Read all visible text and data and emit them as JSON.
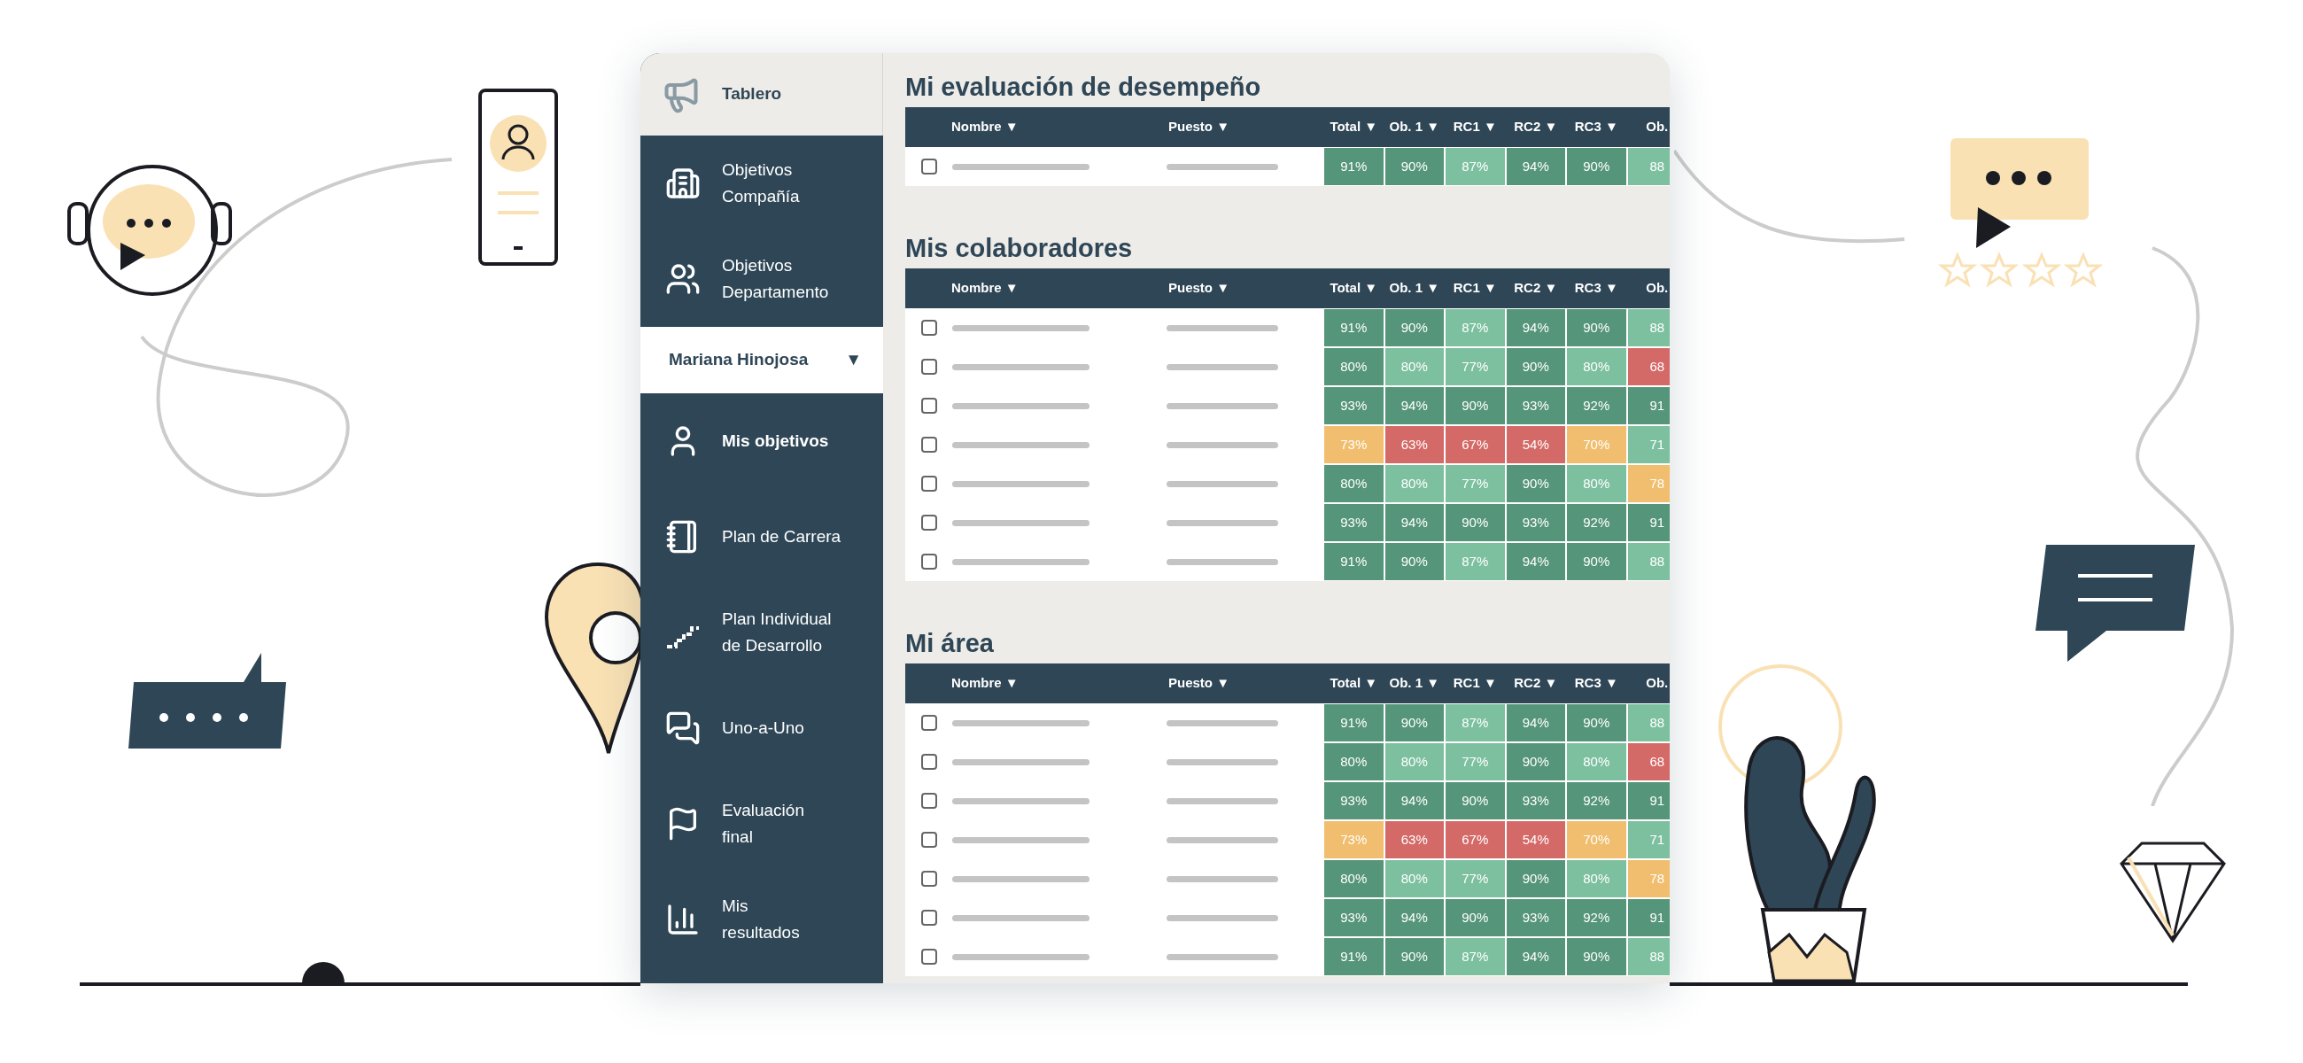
{
  "sidebar": {
    "items": [
      {
        "kind": "header",
        "lines": [
          "Tablero"
        ],
        "selected": false
      },
      {
        "kind": "nav",
        "lines": [
          "Objetivos",
          "Compañía"
        ],
        "selected": false
      },
      {
        "kind": "nav",
        "lines": [
          "Objetivos",
          "Departamento"
        ],
        "selected": false
      },
      {
        "kind": "user",
        "lines": [
          "Mariana Hinojosa"
        ],
        "caret": "▼",
        "selected": false
      },
      {
        "kind": "nav",
        "lines": [
          "Mis objetivos"
        ],
        "selected": true
      },
      {
        "kind": "nav",
        "lines": [
          "Plan de Carrera"
        ],
        "selected": false
      },
      {
        "kind": "nav",
        "lines": [
          "Plan Individual",
          "de Desarrollo"
        ],
        "selected": false
      },
      {
        "kind": "nav",
        "lines": [
          "Uno-a-Uno"
        ],
        "selected": false
      },
      {
        "kind": "nav",
        "lines": [
          "Evaluación",
          "final"
        ],
        "selected": false
      },
      {
        "kind": "nav",
        "lines": [
          "Mis",
          "resultados"
        ],
        "selected": false
      }
    ]
  },
  "sections": [
    {
      "title": "Mi evaluación de desempeño",
      "name_header": "Nombre ▼",
      "position_header": "Puesto ▼",
      "score_columns": [
        "Total ▼",
        "Ob. 1 ▼",
        "RC1 ▼",
        "RC2 ▼",
        "RC3 ▼",
        "Ob."
      ],
      "rows": [
        {
          "checked": false,
          "cells": [
            {
              "value": "91%",
              "color": "#559579"
            },
            {
              "value": "90%",
              "color": "#559579"
            },
            {
              "value": "87%",
              "color": "#7dc09f"
            },
            {
              "value": "94%",
              "color": "#559579"
            },
            {
              "value": "90%",
              "color": "#559579"
            },
            {
              "value": "88",
              "color": "#7dc09f"
            }
          ]
        }
      ]
    },
    {
      "title": "Mis colaboradores",
      "name_header": "Nombre ▼",
      "position_header": "Puesto ▼",
      "score_columns": [
        "Total ▼",
        "Ob. 1 ▼",
        "RC1 ▼",
        "RC2 ▼",
        "RC3 ▼",
        "Ob."
      ],
      "rows": [
        {
          "checked": false,
          "cells": [
            {
              "value": "91%",
              "color": "#559579"
            },
            {
              "value": "90%",
              "color": "#559579"
            },
            {
              "value": "87%",
              "color": "#7dc09f"
            },
            {
              "value": "94%",
              "color": "#559579"
            },
            {
              "value": "90%",
              "color": "#559579"
            },
            {
              "value": "88",
              "color": "#7dc09f"
            }
          ]
        },
        {
          "checked": false,
          "cells": [
            {
              "value": "80%",
              "color": "#559579"
            },
            {
              "value": "80%",
              "color": "#7dc09f"
            },
            {
              "value": "77%",
              "color": "#7dc09f"
            },
            {
              "value": "90%",
              "color": "#559579"
            },
            {
              "value": "80%",
              "color": "#7dc09f"
            },
            {
              "value": "68",
              "color": "#d46a67"
            }
          ]
        },
        {
          "checked": false,
          "cells": [
            {
              "value": "93%",
              "color": "#559579"
            },
            {
              "value": "94%",
              "color": "#559579"
            },
            {
              "value": "90%",
              "color": "#559579"
            },
            {
              "value": "93%",
              "color": "#559579"
            },
            {
              "value": "92%",
              "color": "#559579"
            },
            {
              "value": "91",
              "color": "#559579"
            }
          ]
        },
        {
          "checked": false,
          "cells": [
            {
              "value": "73%",
              "color": "#f0be6e"
            },
            {
              "value": "63%",
              "color": "#d46a67"
            },
            {
              "value": "67%",
              "color": "#d46a67"
            },
            {
              "value": "54%",
              "color": "#d46a67"
            },
            {
              "value": "70%",
              "color": "#f0be6e"
            },
            {
              "value": "71",
              "color": "#7dc09f"
            }
          ]
        },
        {
          "checked": false,
          "cells": [
            {
              "value": "80%",
              "color": "#559579"
            },
            {
              "value": "80%",
              "color": "#7dc09f"
            },
            {
              "value": "77%",
              "color": "#7dc09f"
            },
            {
              "value": "90%",
              "color": "#559579"
            },
            {
              "value": "80%",
              "color": "#7dc09f"
            },
            {
              "value": "78",
              "color": "#f0be6e"
            }
          ]
        },
        {
          "checked": false,
          "cells": [
            {
              "value": "93%",
              "color": "#559579"
            },
            {
              "value": "94%",
              "color": "#559579"
            },
            {
              "value": "90%",
              "color": "#559579"
            },
            {
              "value": "93%",
              "color": "#559579"
            },
            {
              "value": "92%",
              "color": "#559579"
            },
            {
              "value": "91",
              "color": "#559579"
            }
          ]
        },
        {
          "checked": false,
          "cells": [
            {
              "value": "91%",
              "color": "#559579"
            },
            {
              "value": "90%",
              "color": "#559579"
            },
            {
              "value": "87%",
              "color": "#7dc09f"
            },
            {
              "value": "94%",
              "color": "#559579"
            },
            {
              "value": "90%",
              "color": "#559579"
            },
            {
              "value": "88",
              "color": "#7dc09f"
            }
          ]
        }
      ]
    },
    {
      "title": "Mi área",
      "name_header": "Nombre ▼",
      "position_header": "Puesto ▼",
      "score_columns": [
        "Total ▼",
        "Ob. 1 ▼",
        "RC1 ▼",
        "RC2 ▼",
        "RC3 ▼",
        "Ob."
      ],
      "rows": [
        {
          "checked": false,
          "cells": [
            {
              "value": "91%",
              "color": "#559579"
            },
            {
              "value": "90%",
              "color": "#559579"
            },
            {
              "value": "87%",
              "color": "#7dc09f"
            },
            {
              "value": "94%",
              "color": "#559579"
            },
            {
              "value": "90%",
              "color": "#559579"
            },
            {
              "value": "88",
              "color": "#7dc09f"
            }
          ]
        },
        {
          "checked": false,
          "cells": [
            {
              "value": "80%",
              "color": "#559579"
            },
            {
              "value": "80%",
              "color": "#7dc09f"
            },
            {
              "value": "77%",
              "color": "#7dc09f"
            },
            {
              "value": "90%",
              "color": "#559579"
            },
            {
              "value": "80%",
              "color": "#7dc09f"
            },
            {
              "value": "68",
              "color": "#d46a67"
            }
          ]
        },
        {
          "checked": false,
          "cells": [
            {
              "value": "93%",
              "color": "#559579"
            },
            {
              "value": "94%",
              "color": "#559579"
            },
            {
              "value": "90%",
              "color": "#559579"
            },
            {
              "value": "93%",
              "color": "#559579"
            },
            {
              "value": "92%",
              "color": "#559579"
            },
            {
              "value": "91",
              "color": "#559579"
            }
          ]
        },
        {
          "checked": false,
          "cells": [
            {
              "value": "73%",
              "color": "#f0be6e"
            },
            {
              "value": "63%",
              "color": "#d46a67"
            },
            {
              "value": "67%",
              "color": "#d46a67"
            },
            {
              "value": "54%",
              "color": "#d46a67"
            },
            {
              "value": "70%",
              "color": "#f0be6e"
            },
            {
              "value": "71",
              "color": "#7dc09f"
            }
          ]
        },
        {
          "checked": false,
          "cells": [
            {
              "value": "80%",
              "color": "#559579"
            },
            {
              "value": "80%",
              "color": "#7dc09f"
            },
            {
              "value": "77%",
              "color": "#7dc09f"
            },
            {
              "value": "90%",
              "color": "#559579"
            },
            {
              "value": "80%",
              "color": "#7dc09f"
            },
            {
              "value": "78",
              "color": "#f0be6e"
            }
          ]
        },
        {
          "checked": false,
          "cells": [
            {
              "value": "93%",
              "color": "#559579"
            },
            {
              "value": "94%",
              "color": "#559579"
            },
            {
              "value": "90%",
              "color": "#559579"
            },
            {
              "value": "93%",
              "color": "#559579"
            },
            {
              "value": "92%",
              "color": "#559579"
            },
            {
              "value": "91",
              "color": "#559579"
            }
          ]
        },
        {
          "checked": false,
          "cells": [
            {
              "value": "91%",
              "color": "#559579"
            },
            {
              "value": "90%",
              "color": "#559579"
            },
            {
              "value": "87%",
              "color": "#7dc09f"
            },
            {
              "value": "94%",
              "color": "#559579"
            },
            {
              "value": "90%",
              "color": "#559579"
            },
            {
              "value": "88",
              "color": "#7dc09f"
            }
          ]
        }
      ]
    }
  ]
}
